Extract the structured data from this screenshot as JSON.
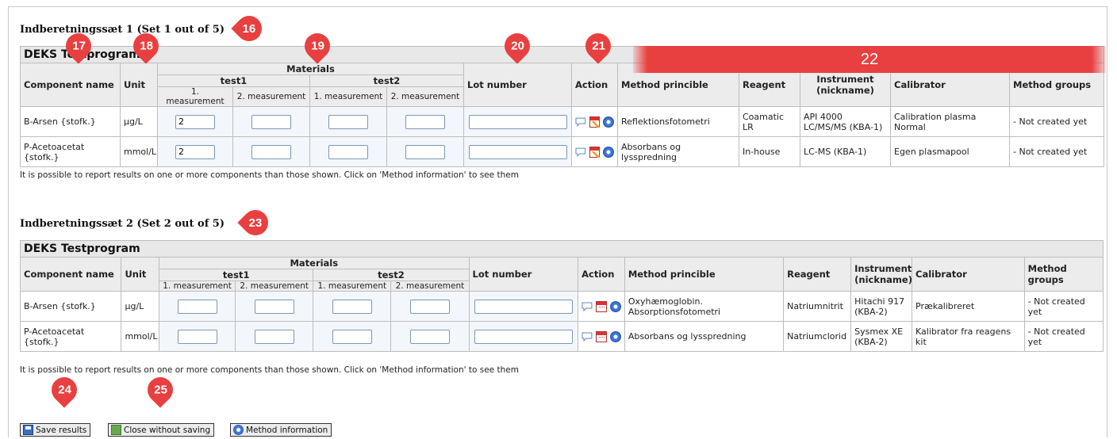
{
  "sets": [
    {
      "title": "Indberetningssæt 1 (Set 1 out of 5)",
      "program": "DEKS Testprogram",
      "rows": [
        {
          "component": "B-Arsen {stofk.}",
          "unit": "µg/L",
          "m1": "2",
          "m2": "",
          "m3": "",
          "m4": "",
          "lot": "",
          "method": "Reflektionsfotometri",
          "reagent": "Coamatic LR",
          "instrument": "API 4000 LC/MS/MS (KBA-1)",
          "calibrator": "Calibration plasma Normal",
          "groups": "- Not created yet"
        },
        {
          "component": "P-Acetoacetat {stofk.}",
          "unit": "mmol/L",
          "m1": "2",
          "m2": "",
          "m3": "",
          "m4": "",
          "lot": "",
          "method": "Absorbans og lysspredning",
          "reagent": "In-house",
          "instrument": "LC-MS (KBA-1)",
          "calibrator": "Egen plasmapool",
          "groups": "- Not created yet"
        }
      ]
    },
    {
      "title": "Indberetningssæt 2 (Set 2 out of 5)",
      "program": "DEKS Testprogram",
      "rows": [
        {
          "component": "B-Arsen {stofk.}",
          "unit": "µg/L",
          "m1": "",
          "m2": "",
          "m3": "",
          "m4": "",
          "lot": "",
          "method": "Oxyhæmoglobin. Absorptionsfotometri",
          "reagent": "Natriumnitrit",
          "instrument": "Hitachi 917 (KBA-2)",
          "calibrator": "Prækalibreret",
          "groups": "- Not created yet"
        },
        {
          "component": "P-Acetoacetat {stofk.}",
          "unit": "mmol/L",
          "m1": "",
          "m2": "",
          "m3": "",
          "m4": "",
          "lot": "",
          "method": "Absorbans og lysspredning",
          "reagent": "Natriumclorid",
          "instrument": "Sysmex XE (KBA-2)",
          "calibrator": "Kalibrator fra reagens kit",
          "groups": "- Not created yet"
        }
      ]
    }
  ],
  "headers": {
    "component": "Component name",
    "unit": "Unit",
    "materials": "Materials",
    "test1": "test1",
    "test2": "test2",
    "m1": "1. measurement",
    "m2": "2. measurement",
    "lot": "Lot number",
    "action": "Action",
    "method": "Method princible",
    "reagent": "Reagent",
    "instrument": "Instrument (nickname)",
    "calibrator": "Calibrator",
    "groups": "Method groups"
  },
  "note": "It is possible to report results on one or more components than those shown. Click on 'Method information' to see them",
  "buttons": {
    "save": "Save results",
    "close": "Close without saving",
    "method": "Method information"
  },
  "markers": [
    "16",
    "17",
    "18",
    "19",
    "20",
    "21",
    "22",
    "23",
    "24",
    "25"
  ],
  "colors": {
    "marker": "#e84040",
    "header_bg": "#ececec",
    "input_border": "#7a98b8"
  }
}
